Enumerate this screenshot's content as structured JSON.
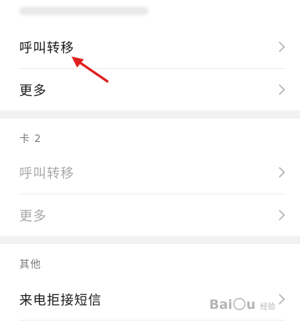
{
  "card1": {
    "rows": [
      {
        "label": "呼叫转移"
      },
      {
        "label": "更多"
      }
    ]
  },
  "card2": {
    "header": "卡 2",
    "rows": [
      {
        "label": "呼叫转移"
      },
      {
        "label": "更多"
      }
    ]
  },
  "other": {
    "header": "其他",
    "rows": [
      {
        "label": "来电拒接短信"
      }
    ]
  },
  "watermark": {
    "brand": "Bai",
    "brand_tail": "u",
    "sub": "经验"
  },
  "colors": {
    "annotation_arrow": "#e02020",
    "disabled_text": "#a8a8a8",
    "section_gap": "#f2f2f2"
  }
}
